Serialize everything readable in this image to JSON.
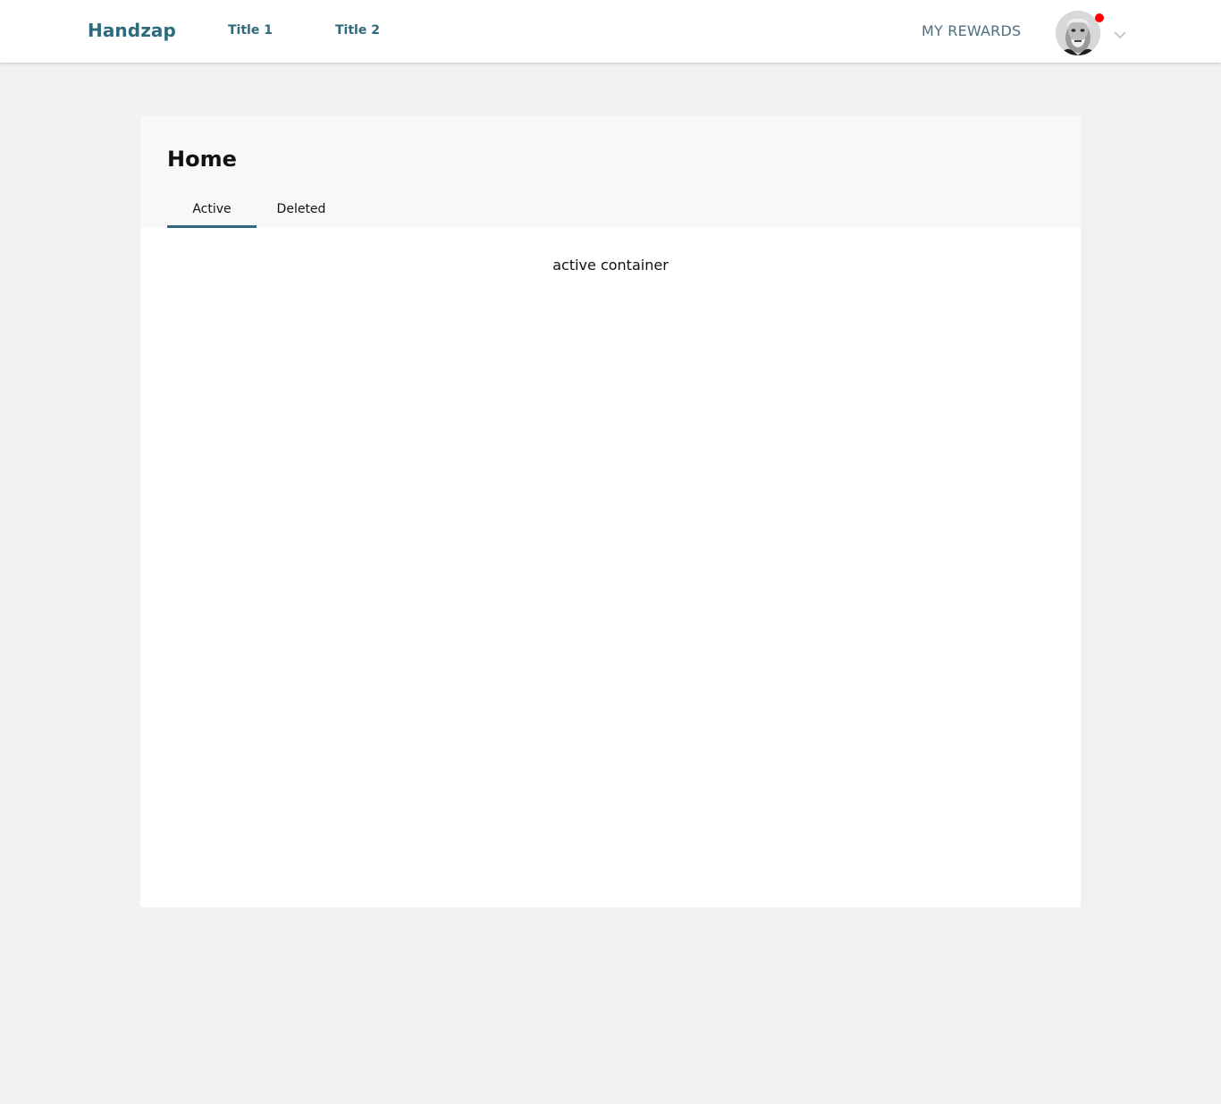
{
  "navbar": {
    "brand": "Handzap",
    "links": [
      "Title 1",
      "Title 2"
    ],
    "rewards_label": "MY REWARDS",
    "avatar_icon": "user-avatar-photo",
    "notification_color": "#ff0000",
    "dropdown_icon": "chevron-down-icon"
  },
  "page": {
    "title": "Home",
    "tabs": [
      {
        "label": "Active",
        "selected": true
      },
      {
        "label": "Deleted",
        "selected": false
      }
    ],
    "content": "active container"
  },
  "colors": {
    "accent": "#2d6a7c",
    "background": "#f1f1f1",
    "card": "#ffffff",
    "card_header": "#f8f8f8"
  }
}
